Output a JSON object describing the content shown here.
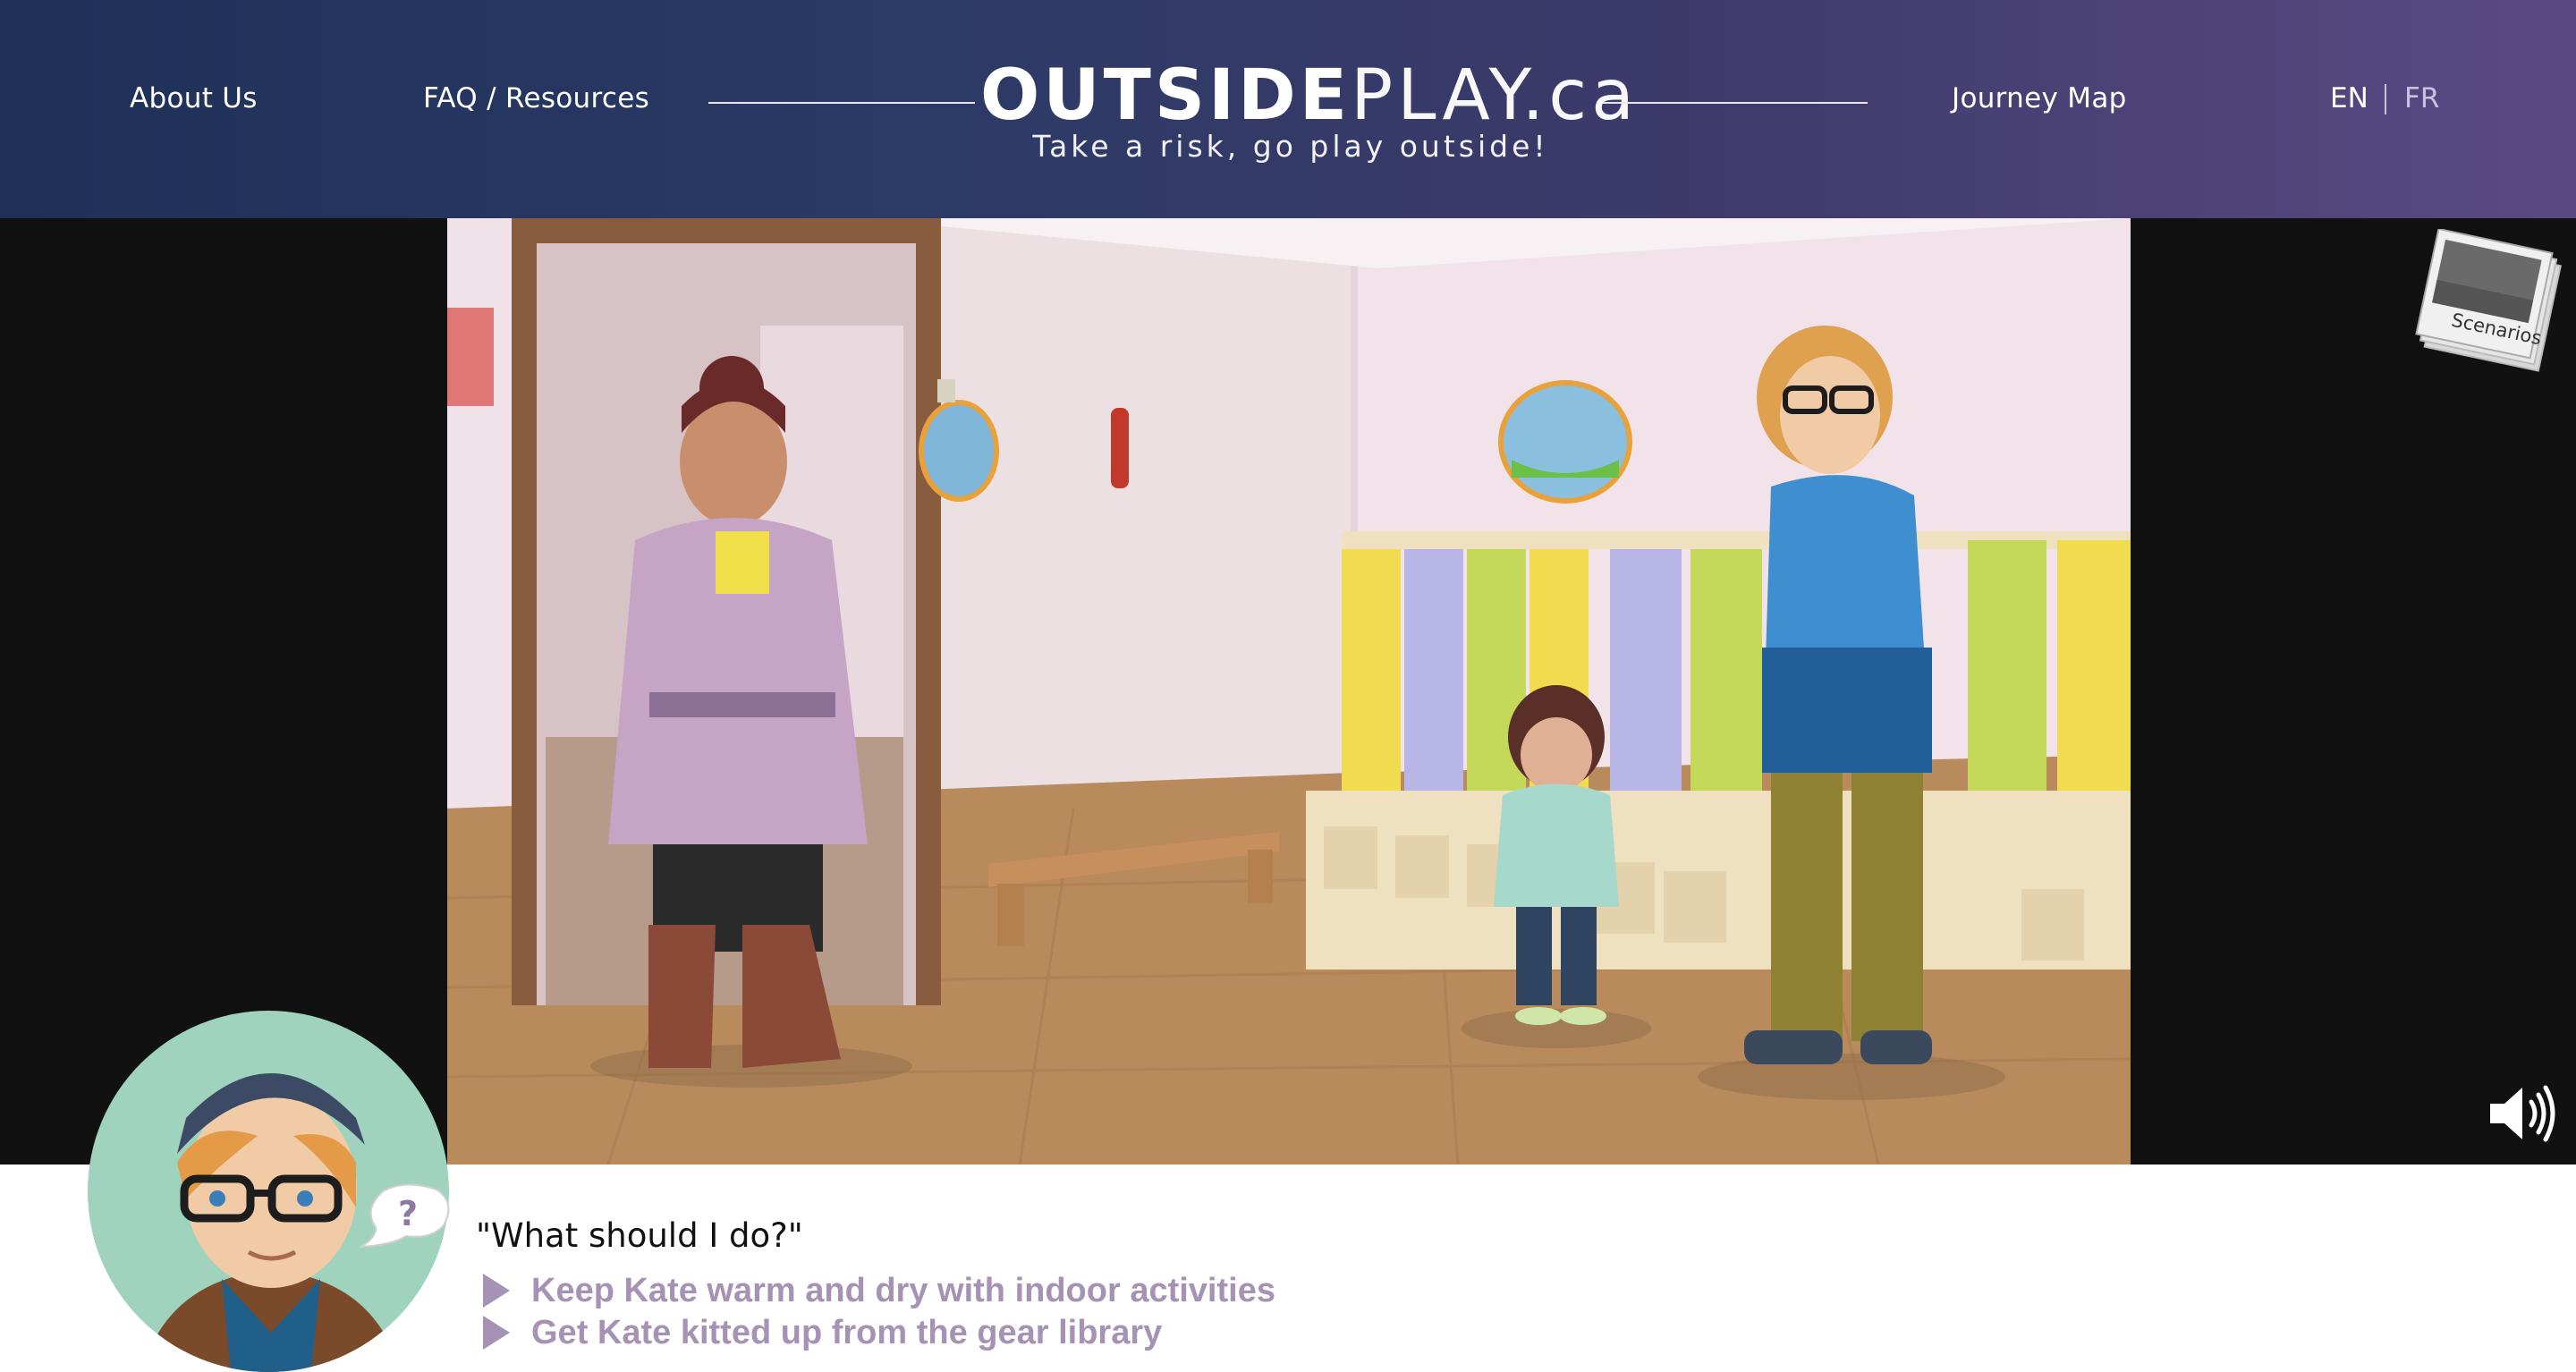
{
  "header": {
    "nav_left": [
      "About Us",
      "FAQ / Resources"
    ],
    "nav_right": "Journey Map",
    "logo_bold": "OUTSIDE",
    "logo_light": "PLAY.ca",
    "tagline": "Take a risk, go play outside!",
    "lang_active": "EN",
    "lang_inactive": "FR"
  },
  "scene": {
    "scenarios_label": "Scenarios",
    "characters": [
      "mother-character",
      "child-character",
      "educator-character"
    ]
  },
  "dialog": {
    "prompt": "\"What should I do?\"",
    "choices": [
      "Keep Kate warm and dry with indoor activities",
      "Get Kate kitted up from the gear library"
    ],
    "bubble_symbol": "?"
  },
  "colors": {
    "header_left": "#1e3058",
    "header_right": "#5a4a84",
    "choice_text": "#a692b4",
    "avatar_bg": "#9fd3bd"
  },
  "icons": [
    "speaker-icon",
    "scenarios-photo-icon",
    "question-bubble-icon",
    "choice-arrow-icon"
  ]
}
